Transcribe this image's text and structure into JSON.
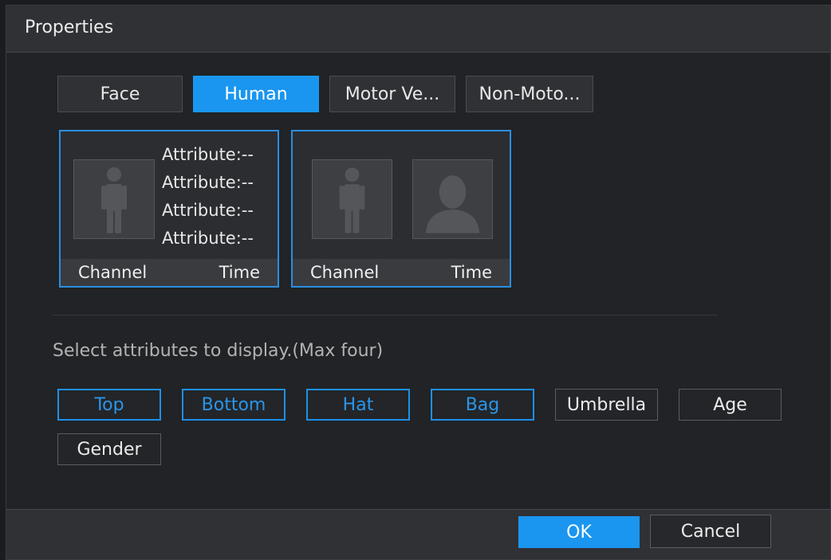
{
  "dialog": {
    "title": "Properties",
    "tabs": [
      {
        "label": "Face",
        "active": false
      },
      {
        "label": "Human",
        "active": true
      },
      {
        "label": "Motor Ve...",
        "active": false
      },
      {
        "label": "Non-Moto...",
        "active": false
      }
    ],
    "preview_cards": [
      {
        "icon": "person-silhouette-icon",
        "attributes": [
          "Attribute:--",
          "Attribute:--",
          "Attribute:--",
          "Attribute:--"
        ],
        "channel_label": "Channel",
        "time_label": "Time"
      },
      {
        "icons": [
          "person-silhouette-icon",
          "face-avatar-icon"
        ],
        "channel_label": "Channel",
        "time_label": "Time"
      }
    ],
    "hint": "Select attributes to display.(Max four)",
    "attribute_options": [
      {
        "label": "Top",
        "selected": true
      },
      {
        "label": "Bottom",
        "selected": true
      },
      {
        "label": "Hat",
        "selected": true
      },
      {
        "label": "Bag",
        "selected": true
      },
      {
        "label": "Umbrella",
        "selected": false
      },
      {
        "label": "Age",
        "selected": false
      },
      {
        "label": "Gender",
        "selected": false
      }
    ],
    "ok_label": "OK",
    "cancel_label": "Cancel",
    "colors": {
      "accent": "#1a96f0",
      "background": "#212326"
    }
  }
}
